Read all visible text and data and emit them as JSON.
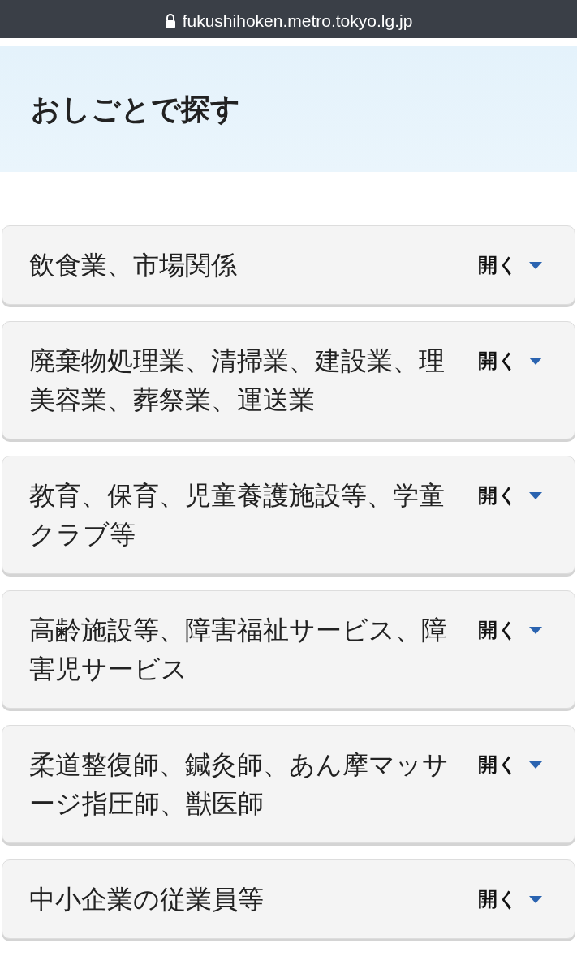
{
  "browser_bar": {
    "url": "fukushihoken.metro.tokyo.lg.jp"
  },
  "page_title": "おしごとで探す",
  "accordion": [
    {
      "label": "飲食業、市場関係",
      "toggle": "開く",
      "expanded": false
    },
    {
      "label": "廃棄物処理業、清掃業、建設業、理美容業、葬祭業、運送業",
      "toggle": "開く",
      "expanded": false
    },
    {
      "label": "教育、保育、児童養護施設等、学童クラブ等",
      "toggle": "開く",
      "expanded": false
    },
    {
      "label": "高齢施設等、障害福祉サービス、障害児サービス",
      "toggle": "開く",
      "expanded": false
    },
    {
      "label": "柔道整復師、鍼灸師、あん摩マッサージ指圧師、獣医師",
      "toggle": "開く",
      "expanded": false
    },
    {
      "label": "中小企業の従業員等",
      "toggle": "開く",
      "expanded": false
    }
  ]
}
